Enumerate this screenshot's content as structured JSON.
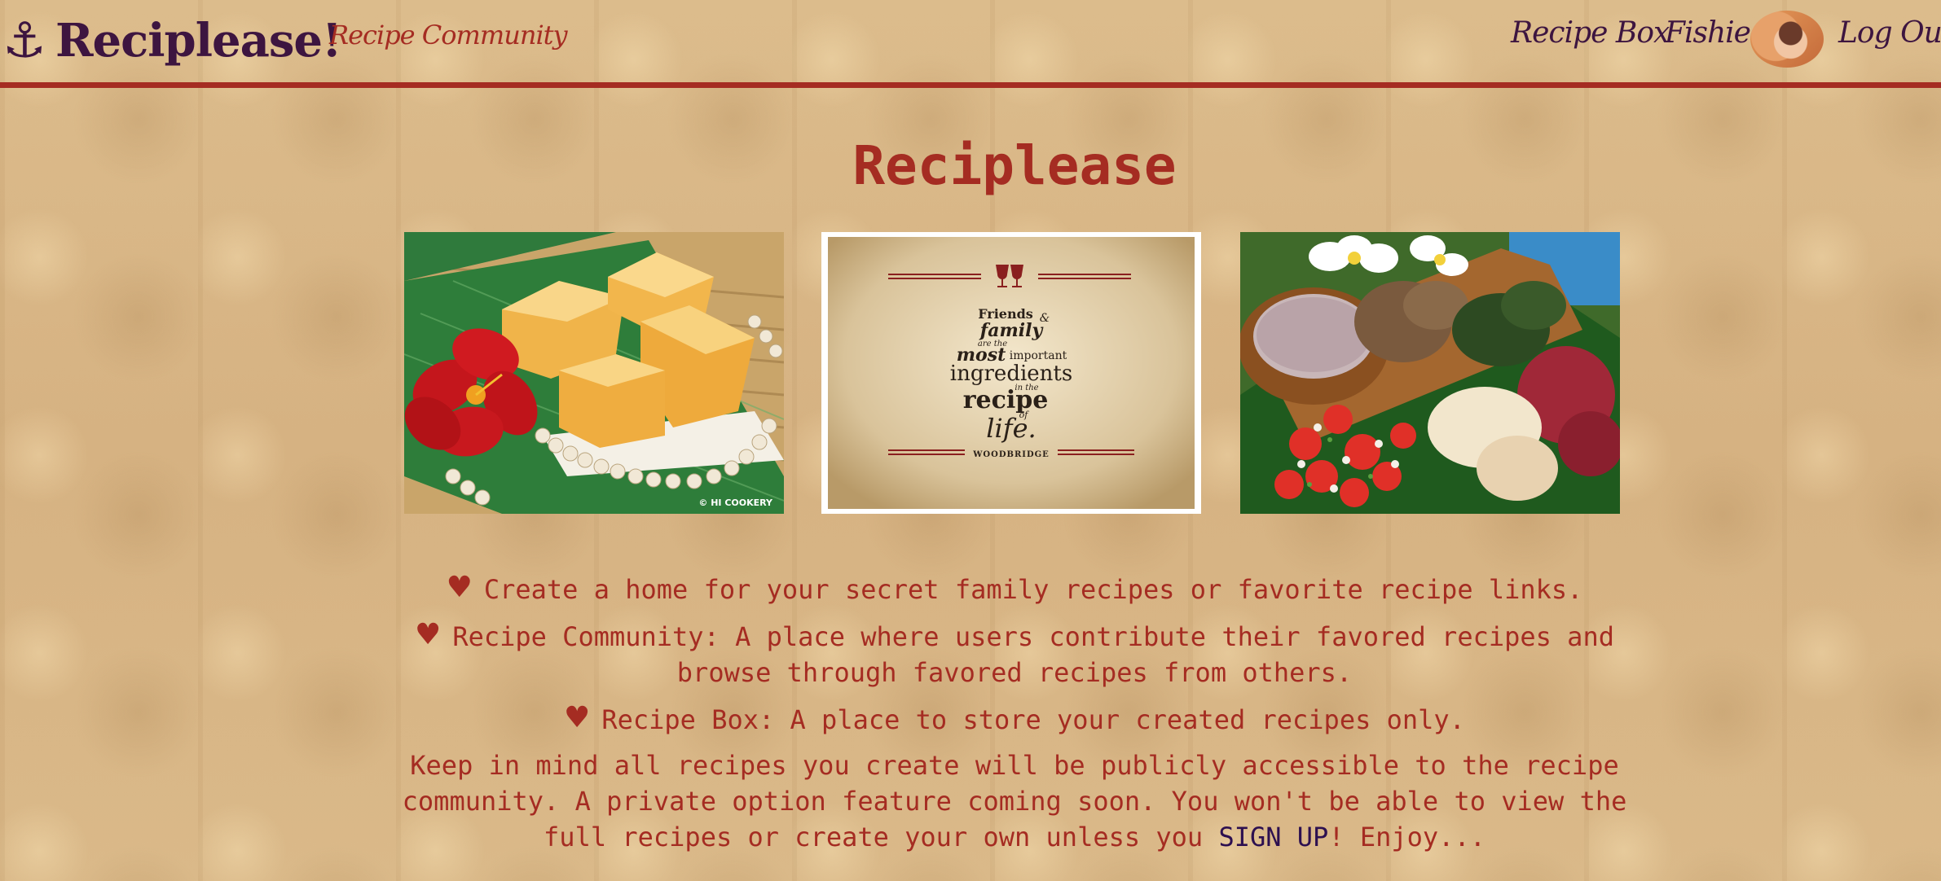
{
  "navbar": {
    "anchor_icon": "⚓",
    "brand": "Reciplease!",
    "community_link": "Recipe Community",
    "recipe_box_link": "Recipe Box",
    "username": "Fishie",
    "logout_link": "Log Out"
  },
  "main": {
    "title": "Reciplease",
    "images": [
      {
        "description_icon": "butter-mochi-food-photo",
        "caption": "© HI COOKERY"
      },
      {
        "description_icon": "quote-poster",
        "lines": [
          "Friends",
          "&",
          "family",
          "are the",
          "most",
          "important",
          "ingredients",
          "in the",
          "recipe",
          "of",
          "life."
        ],
        "footer": "WOODBRIDGE"
      },
      {
        "description_icon": "hawaiian-plate-food-photo"
      }
    ],
    "features": [
      {
        "icon": "heart-icon",
        "text": "Create a home for your secret family recipes or favorite recipe links."
      },
      {
        "icon": "heart-icon",
        "text": "Recipe Community: A place where users contribute their favored recipes and browse through favored recipes from others."
      },
      {
        "icon": "heart-icon",
        "text": "Recipe Box: A place to store your created recipes only."
      }
    ],
    "notice_before": "Keep in mind all recipes you create will be publicly accessible to the recipe community. A private option feature coming soon. You won't be able to view the full recipes or create your own unless you ",
    "signup_link": "SIGN UP",
    "notice_after": "! Enjoy..."
  },
  "colors": {
    "accent_red": "#a52c22",
    "brand_purple": "#3d1540",
    "background": "#d9b888"
  }
}
